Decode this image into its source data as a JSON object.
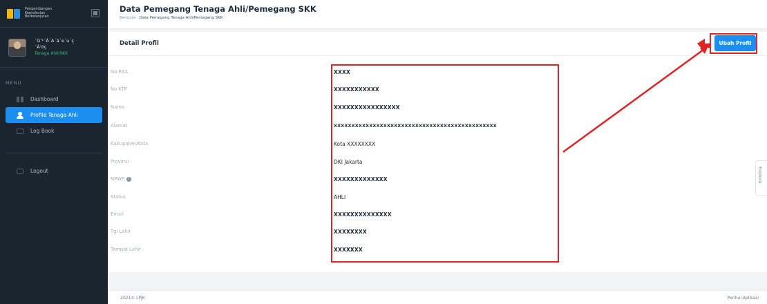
{
  "brand": {
    "lines": [
      "Pengembangan",
      "Keprofesian",
      "Berkelanjutan"
    ]
  },
  "user": {
    "name": "´G’¹´Á´A´á´e´u´ç",
    "name2": "´Á’óç",
    "role": "Tenaga Ahli/SKK"
  },
  "sidebar": {
    "menu_label": "MENU",
    "items": [
      {
        "label": "Dashboard",
        "icon": "grid-icon"
      },
      {
        "label": "Profile Tenaga Ahli",
        "icon": "person-icon",
        "active": true
      },
      {
        "label": "Log Book",
        "icon": "book-icon"
      },
      {
        "label": "Logout",
        "icon": "logout-icon"
      }
    ]
  },
  "header": {
    "title": "Data Pemegang Tenaga Ahli/Pemegang SKK",
    "breadcrumb_home": "Beranda",
    "breadcrumb_sep": "-",
    "breadcrumb_current": "Data Pemegang Tenaga Ahli/Pemegang SKK"
  },
  "card": {
    "title": "Detail Profil",
    "edit_button": "Ubah Profil",
    "fields": [
      {
        "label": "No RKA",
        "value": "XXXX"
      },
      {
        "label": "No KTP",
        "value": "XXXXXXXXXXX"
      },
      {
        "label": "Nama",
        "value": "XXXXXXXXXXXXXXXX"
      },
      {
        "label": "Alamat",
        "value": "XXXXXXXXXXXXXXXXXXXXXXXXXXXXXXXXXXXXXXXXXXXXXX"
      },
      {
        "label": "Kabupaten/Kota",
        "value": "Kota XXXXXXXX"
      },
      {
        "label": "Provinsi",
        "value": "DKI Jakarta"
      },
      {
        "label": "NPWP",
        "value": "XXXXXXXXXXXXX",
        "has_info": true
      },
      {
        "label": "Status",
        "value": "AHLI"
      },
      {
        "label": "Email",
        "value": "XXXXXXXXXXXXXX"
      },
      {
        "label": "Tgl Lahir",
        "value": "XXXXXXXX"
      },
      {
        "label": "Tempat Lahir",
        "value": "XXXXXXX"
      }
    ]
  },
  "explore": "Explore",
  "footer": {
    "left": "2021© LPJK",
    "right": "Perihal Aplikasi"
  },
  "colors": {
    "sidebar_bg": "#1a2530",
    "accent": "#1b8ef0",
    "role_green": "#35c07a",
    "annotation_red": "#e02424"
  }
}
